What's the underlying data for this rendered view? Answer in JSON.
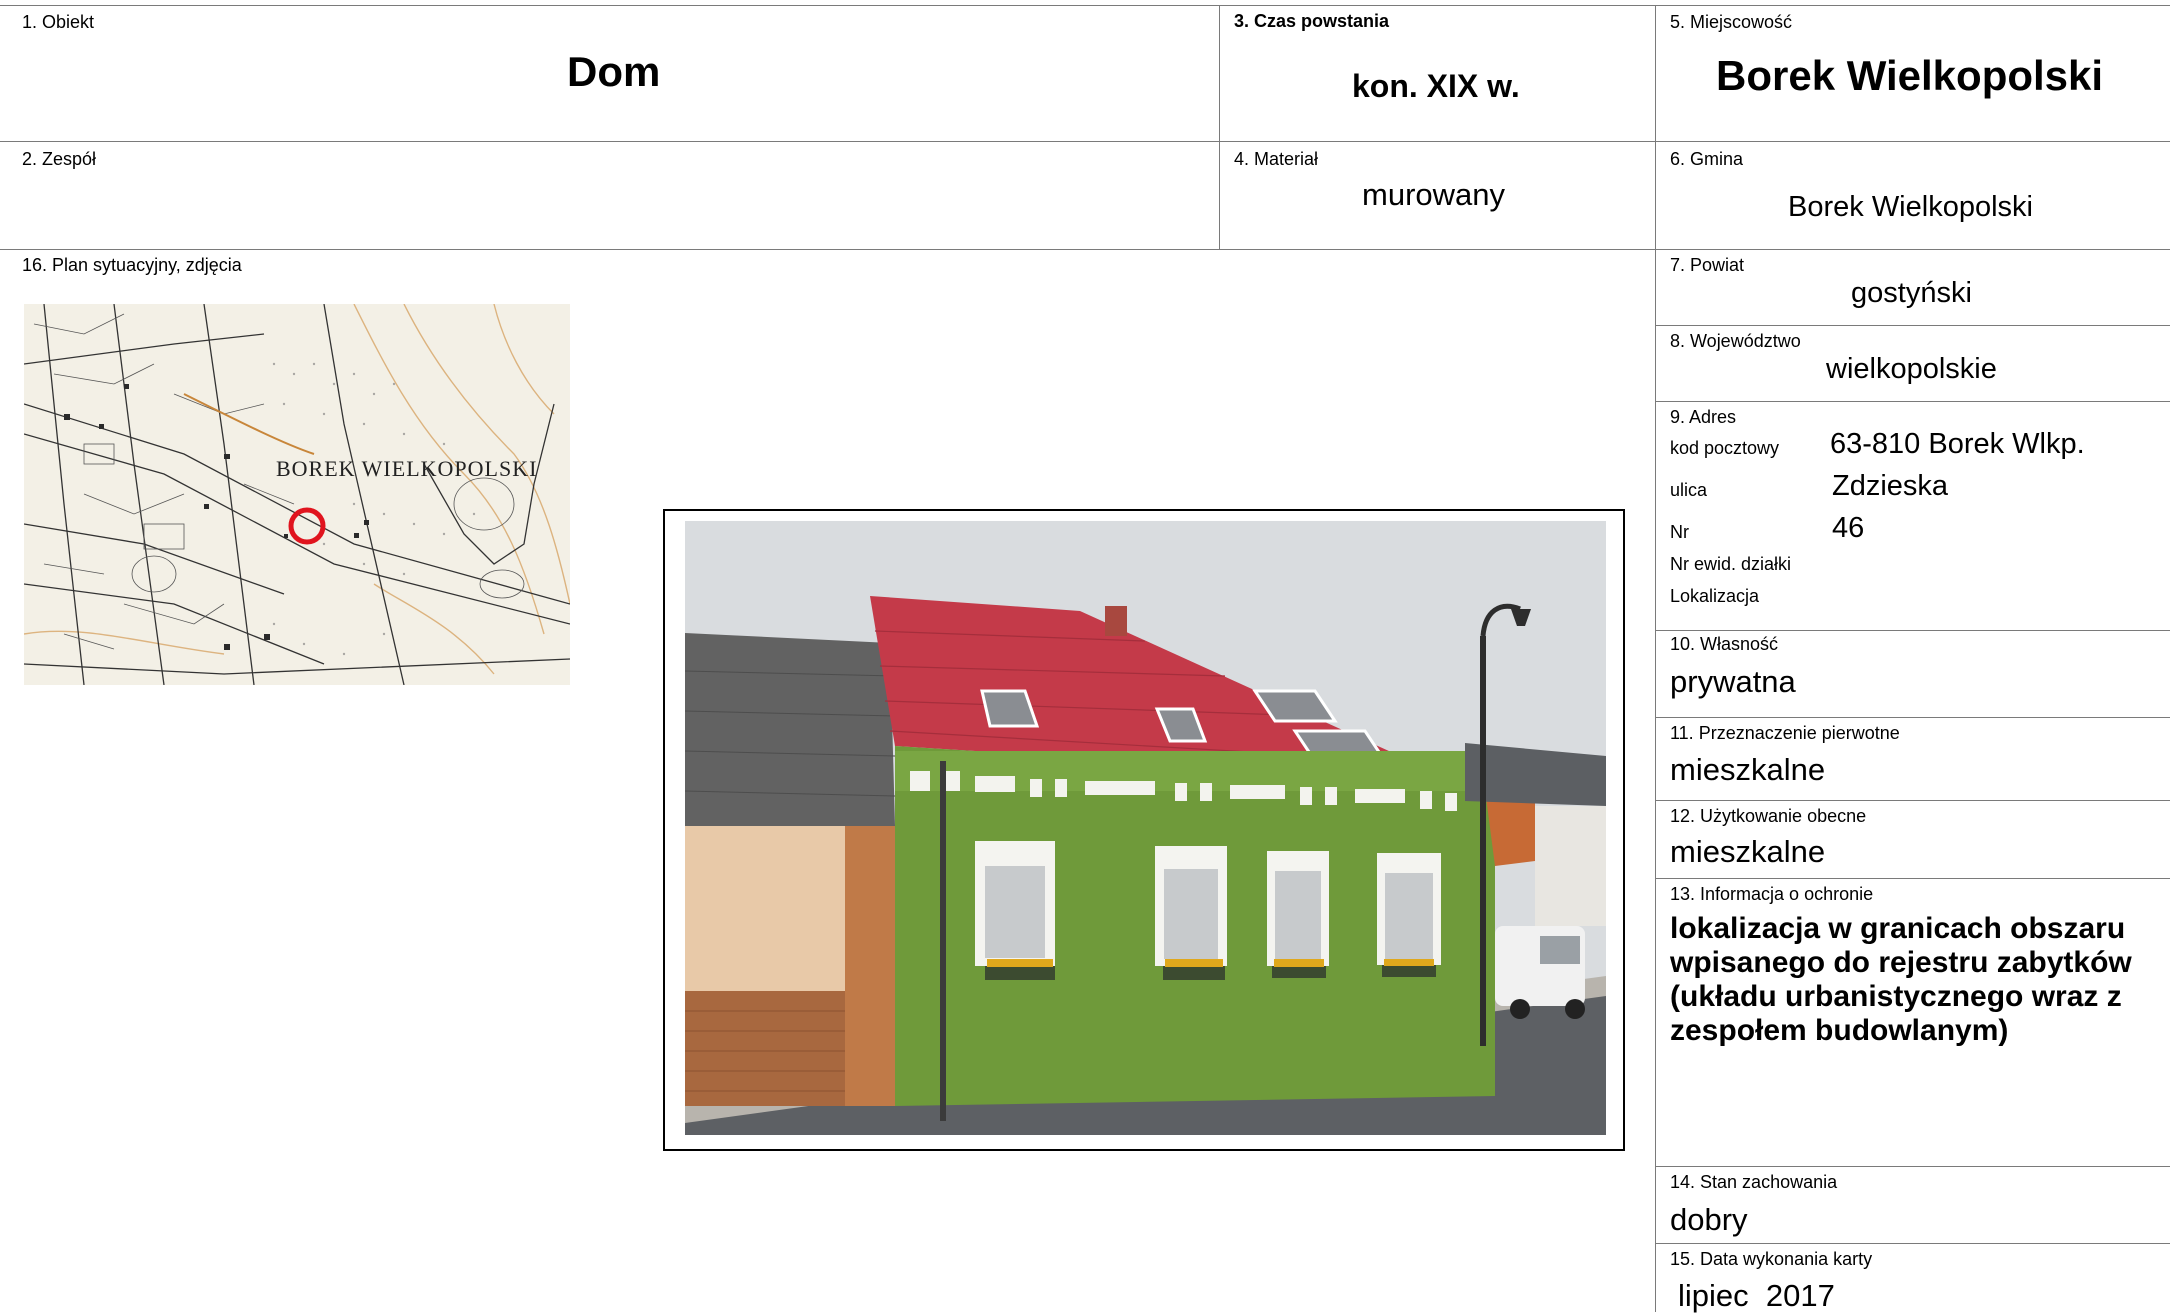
{
  "fields": {
    "obiekt": {
      "label": "1. Obiekt",
      "value": "Dom"
    },
    "zespol": {
      "label": "2. Zespół",
      "value": ""
    },
    "czas": {
      "label": "3. Czas powstania",
      "value": "kon. XIX w."
    },
    "material": {
      "label": "4. Materiał",
      "value": "murowany"
    },
    "miejscowosc": {
      "label": "5. Miejscowość",
      "value": "Borek Wielkopolski"
    },
    "gmina": {
      "label": "6. Gmina",
      "value": "Borek Wielkopolski"
    },
    "powiat": {
      "label": "7. Powiat",
      "value": "gostyński"
    },
    "wojewodztwo": {
      "label": "8. Województwo",
      "value": "wielkopolskie"
    },
    "adres": {
      "label": "9. Adres",
      "kod_label": "kod pocztowy",
      "kod_value": "63-810 Borek Wlkp.",
      "ulica_label": "ulica",
      "ulica_value": "Zdzieska",
      "nr_label": "Nr",
      "nr_value": "46",
      "dzialka_label": "Nr ewid. działki",
      "lokalizacja_label": "Lokalizacja"
    },
    "wlasnosc": {
      "label": "10. Własność",
      "value": "prywatna"
    },
    "przeznaczenie": {
      "label": "11. Przeznaczenie pierwotne",
      "value": "mieszkalne"
    },
    "uzytkowanie": {
      "label": "12. Użytkowanie obecne",
      "value": "mieszkalne"
    },
    "ochrona": {
      "label": "13. Informacja o ochronie",
      "value": "lokalizacja w granicach obszaru wpisanego do rejestru zabytków (układu urbanistycznego wraz z zespołem budowlanym)"
    },
    "stan": {
      "label": "14. Stan zachowania",
      "value": "dobry"
    },
    "data": {
      "label": "15. Data wykonania karty",
      "value": "lipiec  2017"
    },
    "plan": {
      "label": "16. Plan sytuacyjny, zdjęcia"
    }
  },
  "map": {
    "place_name": "BOREK  WIELKOPOLSKI",
    "marker_color": "#e0141e"
  }
}
